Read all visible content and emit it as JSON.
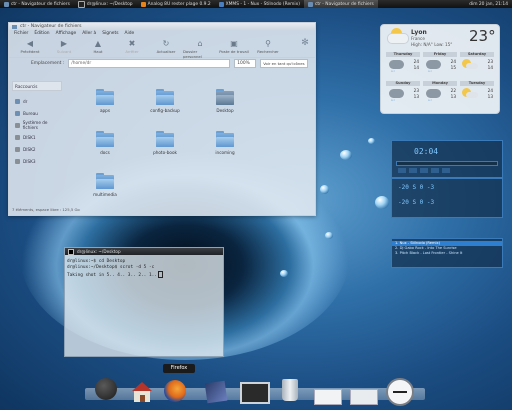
{
  "taskbar": {
    "tasks": [
      {
        "label": "ctr - Navigateur de fichiers"
      },
      {
        "label": "dr@linux: ~/Desktop"
      },
      {
        "label": "Analog 8U rester plage 0.9.2"
      },
      {
        "label": "XMMS - 1 - Nux - Stilnodo (Remix)"
      },
      {
        "label": "ctr - Navigateur de fichiers"
      }
    ],
    "clock": "dim 20 jan, 21:14"
  },
  "file_manager": {
    "title": "ctr - Navigateur de fichiers",
    "menu": [
      "Fichier",
      "Édition",
      "Affichage",
      "Aller à",
      "Signets",
      "Aide"
    ],
    "toolbar": [
      {
        "label": "Précédent",
        "icon": "arrow-left-icon"
      },
      {
        "label": "Suivant",
        "icon": "arrow-right-icon"
      },
      {
        "label": "Haut",
        "icon": "arrow-up-icon"
      },
      {
        "label": "Arrêter",
        "icon": "stop-icon"
      },
      {
        "label": "Actualiser",
        "icon": "refresh-icon"
      },
      {
        "label": "Dossier personnel",
        "icon": "home-icon"
      },
      {
        "label": "Poste de travail",
        "icon": "computer-icon"
      },
      {
        "label": "Rechercher",
        "icon": "search-icon"
      }
    ],
    "location_label": "Emplacement :",
    "location_value": "/home/dr",
    "zoom": "100%",
    "view_mode": "Voir en tant qu'icônes",
    "sidebar_title": "Raccourcis",
    "sidebar_items": [
      "dr",
      "Bureau",
      "Système de fichiers",
      "DISK1",
      "DISK2",
      "DISK3"
    ],
    "files": [
      "apps",
      "config-backup",
      "Desktop",
      "docs",
      "photo-book",
      "incoming",
      "multimedia"
    ],
    "status": "7 éléments, espace libre : 125,5 Go"
  },
  "terminal": {
    "title": "dr@linux: ~/Desktop",
    "lines": [
      "dr@linux:~$ cd Desktop",
      "dr@linux:~/Desktop$ scrot -d 5 -c",
      "Taking shot in 5.. 4.. 3.. 2.. 1.."
    ]
  },
  "weather": {
    "city": "Lyon",
    "country": "France",
    "temp": "23°",
    "high_low": "High: N/A°  Low: 15°",
    "days": [
      {
        "day": "Thursday",
        "hi": "24",
        "lo": "14"
      },
      {
        "day": "Friday",
        "hi": "24",
        "lo": "15"
      },
      {
        "day": "Saturday",
        "hi": "23",
        "lo": "14"
      },
      {
        "day": "Sunday",
        "hi": "23",
        "lo": "13"
      },
      {
        "day": "Monday",
        "hi": "22",
        "lo": "13"
      },
      {
        "day": "Tuesday",
        "hi": "24",
        "lo": "13"
      }
    ]
  },
  "player": {
    "time": "02:04",
    "eq1": "-20  S  0  -3",
    "eq2": "-20  S  0  -3",
    "playlist": [
      "1. Nux - Stilnodo (Remix)",
      "2. DJ Gabo Rock - Into The Sunrise",
      "3. Pitch Black - Lost Frontier - Shine It"
    ]
  },
  "dock": {
    "tooltip": "Firefox",
    "icons": [
      "power-icon",
      "home-icon",
      "firefox-icon",
      "settings-icon",
      "terminal-icon",
      "trash-icon",
      "window-icon",
      "display-icon",
      "clock-icon"
    ]
  }
}
